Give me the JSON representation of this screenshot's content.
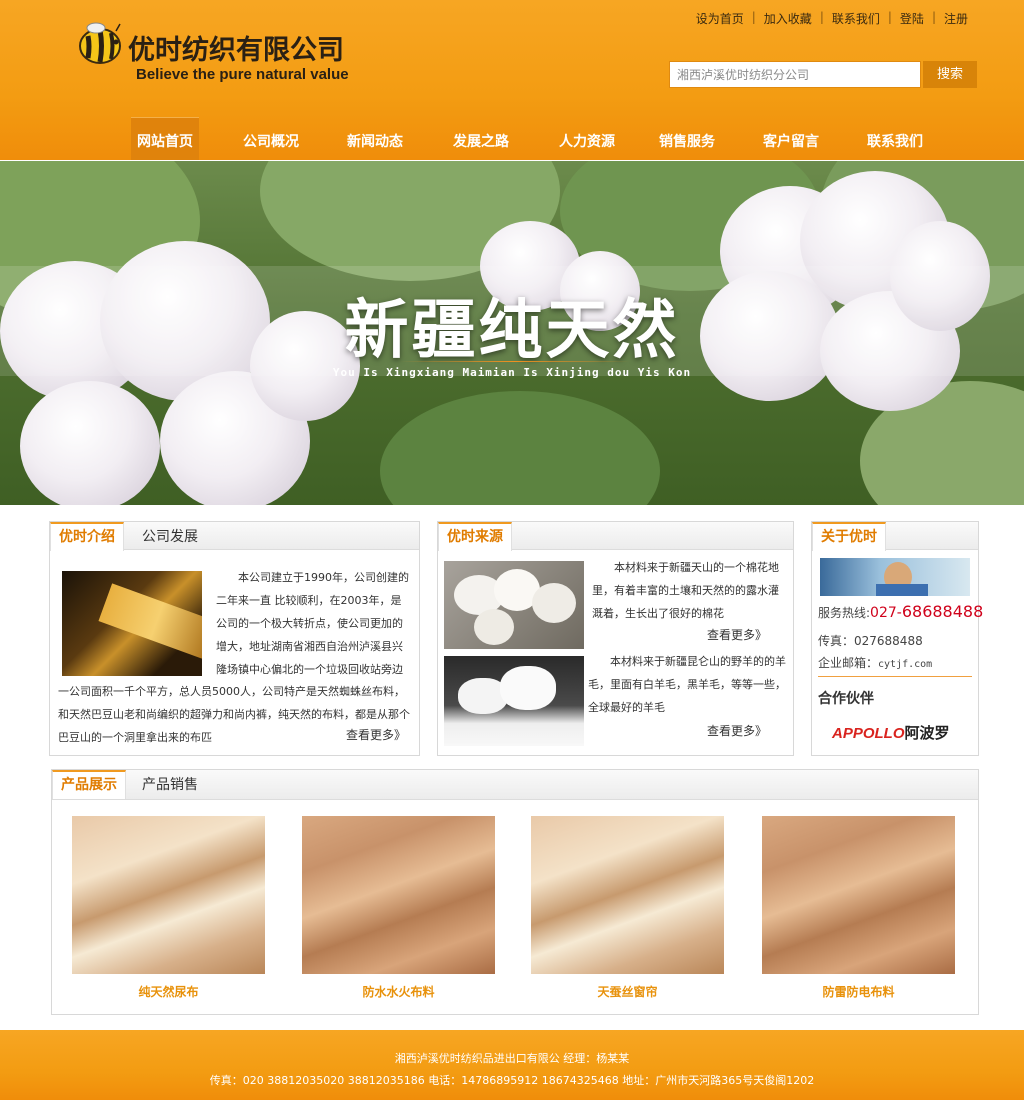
{
  "colors": {
    "accent": "#f39c12",
    "tab_active": "#e07c00",
    "phone": "#d0021b",
    "product_label": "#e8920c"
  },
  "header": {
    "logo_title": "优时纺织有限公司",
    "logo_subtitle": "Believe the pure natural value",
    "top_links": [
      "设为首页",
      "加入收藏",
      "联系我们",
      "登陆",
      "注册"
    ],
    "search": {
      "value": "湘西泸溪优时纺织分公司",
      "button": "搜索"
    }
  },
  "nav": {
    "items": [
      "网站首页",
      "公司概况",
      "新闻动态",
      "发展之路",
      "人力资源",
      "销售服务",
      "客户留言",
      "联系我们"
    ],
    "active_index": 0
  },
  "banner": {
    "title": "新疆纯天然",
    "subtitle": "You Is Xingxiang Maimian Is Xinjing dou Yis Kon"
  },
  "intro": {
    "tabs": [
      "优时介绍",
      "公司发展"
    ],
    "text": "本公司建立于1990年，公司创建的二年来一直 比较顺利，在2003年，是公司的一个极大转折点，使公司更加的增大，地址湖南省湘西自治州泸溪县兴隆场镇中心偏北的一个垃圾回收站旁边一公司面积一千个平方，总人员5000人，公司特产是天然蜘蛛丝布料，和天然巴豆山老和尚编织的超弹力和尚内裤，纯天然的布料，都是从那个巴豆山的一个洞里拿出来的布匹",
    "more": "查看更多》"
  },
  "source": {
    "tabs": [
      "优时来源"
    ],
    "items": [
      {
        "text": "本材料来于新疆天山的一个棉花地里，有着丰富的土壤和天然的的露水灌溉着，生长出了很好的棉花",
        "more": "查看更多》"
      },
      {
        "text": "本材料来于新疆昆仑山的野羊的的羊毛，里面有白羊毛，黑羊毛，等等一些，全球最好的羊毛",
        "more": "查看更多》"
      }
    ]
  },
  "about": {
    "title": "关于优时",
    "hotline_label": "服务热线:",
    "hotline_prefix": "027-",
    "hotline_number": "68688488",
    "fax": "传真：027688488",
    "email_label": "企业邮箱：",
    "email": "cytjf.com",
    "partners_title": "合作伙伴",
    "partner_logo_en": "APPOLLO",
    "partner_logo_cn": "阿波罗"
  },
  "products": {
    "tabs": [
      "产品展示",
      "产品销售"
    ],
    "items": [
      {
        "label": "纯天然尿布",
        "style": "light"
      },
      {
        "label": "防水水火布料",
        "style": "tan"
      },
      {
        "label": "天蚕丝窗帘",
        "style": "light"
      },
      {
        "label": "防雷防电布料",
        "style": "tan"
      }
    ]
  },
  "footer": {
    "line1": "湘西泸溪优时纺织品进出口有限公      经理：杨某某",
    "line2": "传真：020 38812035020 38812035186    电话：14786895912 18674325468  地址：广州市天河路365号天俊阁1202"
  }
}
